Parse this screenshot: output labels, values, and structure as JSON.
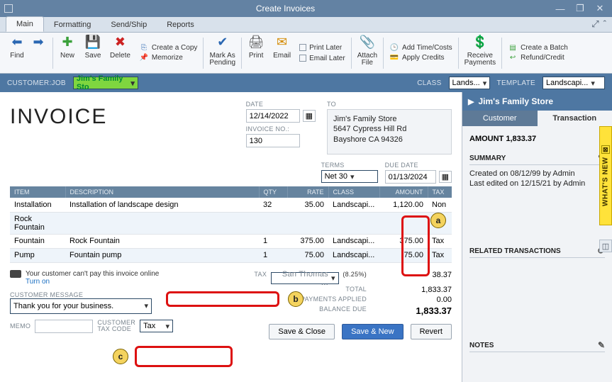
{
  "window": {
    "title": "Create Invoices"
  },
  "tabs": [
    "Main",
    "Formatting",
    "Send/Ship",
    "Reports"
  ],
  "ribbon": {
    "find": "Find",
    "new": "New",
    "save": "Save",
    "delete": "Delete",
    "createcopy": "Create a Copy",
    "memorize": "Memorize",
    "markpending": "Mark As\nPending",
    "print": "Print",
    "email": "Email",
    "printlater": "Print Later",
    "emaillater": "Email Later",
    "attach": "Attach\nFile",
    "addtime": "Add Time/Costs",
    "applycredits": "Apply Credits",
    "receive": "Receive\nPayments",
    "createbatch": "Create a Batch",
    "refund": "Refund/Credit"
  },
  "header": {
    "customerjob_lbl": "CUSTOMER:JOB",
    "customerjob": "Jim's Family Sto",
    "class_lbl": "CLASS",
    "class_val": "Lands...",
    "template_lbl": "TEMPLATE",
    "template_val": "Landscapi..."
  },
  "doc": {
    "title": "INVOICE",
    "date_lbl": "DATE",
    "date": "12/14/2022",
    "invno_lbl": "INVOICE NO.:",
    "invno": "130",
    "to_lbl": "TO",
    "to_name": "Jim's Family Store",
    "to_addr1": "5647 Cypress Hill Rd",
    "to_addr2": "Bayshore CA 94326",
    "terms_lbl": "TERMS",
    "terms": "Net 30",
    "due_lbl": "DUE DATE",
    "due": "01/13/2024",
    "cols": {
      "item": "ITEM",
      "desc": "DESCRIPTION",
      "qty": "QTY",
      "rate": "RATE",
      "class": "CLASS",
      "amount": "AMOUNT",
      "tax": "TAX"
    },
    "rows": [
      {
        "item": "Installation",
        "desc": "Installation of landscape design",
        "qty": "32",
        "rate": "35.00",
        "class": "Landscapi...",
        "amount": "1,120.00",
        "tax": "Non"
      },
      {
        "item": "Rock Fountain",
        "desc": "",
        "qty": "",
        "rate": "",
        "class": "",
        "amount": "",
        "tax": ""
      },
      {
        "item": "Fountain",
        "desc": "Rock Fountain",
        "qty": "1",
        "rate": "375.00",
        "class": "Landscapi...",
        "amount": "375.00",
        "tax": "Tax"
      },
      {
        "item": "Pump",
        "desc": "Fountain pump",
        "qty": "1",
        "rate": "75.00",
        "class": "Landscapi...",
        "amount": "75.00",
        "tax": "Tax"
      }
    ],
    "cannot_pay": "Your customer can't pay this invoice online",
    "turnon": "Turn on",
    "custmsg_lbl": "CUSTOMER MESSAGE",
    "custmsg": "Thank you for your business.",
    "memo_lbl": "MEMO",
    "custtax_lbl": "CUSTOMER\nTAX CODE",
    "custtax": "Tax",
    "tax_lbl": "TAX",
    "tax_item": "San Thomas ...",
    "tax_rate": "(8.25%)",
    "tax_amt": "38.37",
    "total_lbl": "TOTAL",
    "total": "1,833.37",
    "payapplied_lbl": "PAYMENTS APPLIED",
    "payapplied": "0.00",
    "baldue_lbl": "BALANCE DUE",
    "baldue": "1,833.37",
    "saveclose": "Save & Close",
    "savenew": "Save & New",
    "revert": "Revert"
  },
  "side": {
    "title": "Jim's Family Store",
    "tab_customer": "Customer",
    "tab_transaction": "Transaction",
    "amount_lbl": "AMOUNT",
    "amount": "1,833.37",
    "summary": "SUMMARY",
    "line1": "Created on 08/12/99  by  Admin",
    "line2": "Last edited on 12/15/21 by Admin",
    "related": "RELATED TRANSACTIONS",
    "notes": "NOTES"
  },
  "whatsnew": "WHAT'S NEW",
  "anno": {
    "a": "a",
    "b": "b",
    "c": "c"
  }
}
